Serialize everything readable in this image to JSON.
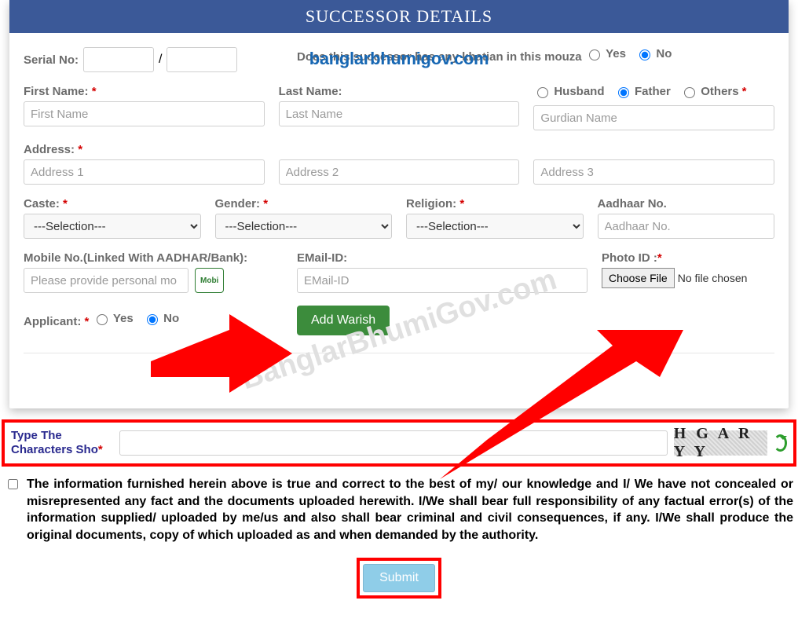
{
  "header": {
    "title": "SUCCESSOR DETAILS"
  },
  "watermark": {
    "top": "banglarbhumigov.com",
    "diag": "BanglarBhumiGov.com"
  },
  "row1": {
    "serial_label": "Serial No:",
    "slash": "/",
    "khatian_q": "Does this successor has any khatian in this mouza",
    "yes": "Yes",
    "no": "No"
  },
  "row2": {
    "first_label": "First Name:",
    "first_ph": "First Name",
    "last_label": "Last Name:",
    "last_ph": "Last Name",
    "husband": "Husband",
    "father": "Father",
    "others": "Others",
    "guardian_ph": "Gurdian Name"
  },
  "row3": {
    "addr_label": "Address:",
    "a1_ph": "Address 1",
    "a2_ph": "Address 2",
    "a3_ph": "Address 3"
  },
  "row4": {
    "caste_label": "Caste:",
    "gender_label": "Gender:",
    "religion_label": "Religion:",
    "aadhaar_label": "Aadhaar No.",
    "aadhaar_ph": "Aadhaar No.",
    "sel_default": "---Selection---"
  },
  "row5": {
    "mobile_label": "Mobile No.(Linked With AADHAR/Bank):",
    "mobile_ph": "Please provide personal mo",
    "mobi_btn": "Mobi",
    "email_label": "EMail-ID:",
    "email_ph": "EMail-ID",
    "photo_label": "Photo ID :",
    "choose_file": "Choose File",
    "no_file": "No file chosen"
  },
  "row6": {
    "applicant_label": "Applicant:",
    "yes": "Yes",
    "no": "No",
    "add_btn": "Add Warish"
  },
  "captcha": {
    "label": "Type The Characters Sho",
    "text": "H G A R Y Y"
  },
  "declaration": "The information furnished herein above is true and correct to the best of my/ our knowledge and I/ We have not concealed or misrepresented any fact and the documents uploaded herewith. I/We shall bear full responsibility of any factual error(s) of the information supplied/ uploaded by me/us and also shall bear criminal and civil consequences, if any. I/We shall produce the original documents, copy of which uploaded as and when demanded by the authority.",
  "submit": "Submit"
}
